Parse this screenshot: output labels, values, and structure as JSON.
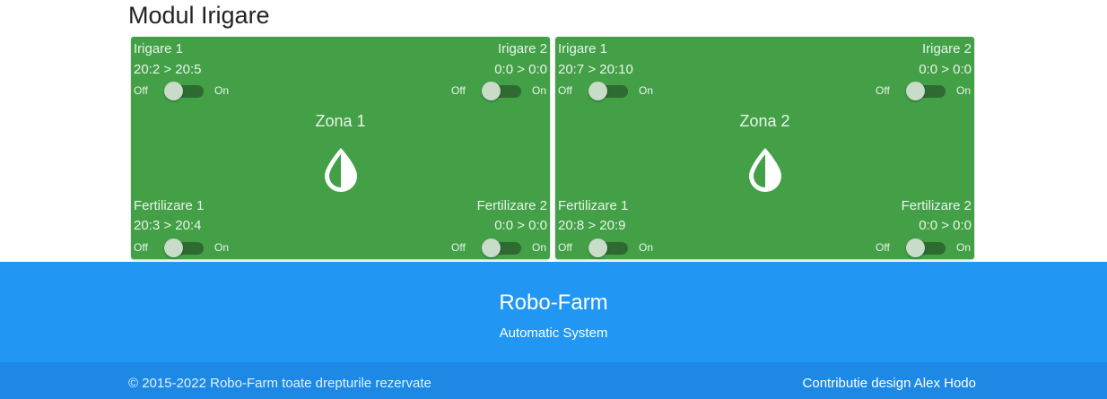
{
  "page": {
    "title": "Modul Irigare"
  },
  "zones": [
    {
      "name": "Zona 1",
      "irigare1": {
        "label": "Irigare 1",
        "schedule": "20:2 > 20:5",
        "off": "Off",
        "on": "On",
        "state": "off"
      },
      "irigare2": {
        "label": "Irigare 2",
        "schedule": "0:0 > 0:0",
        "off": "Off",
        "on": "On",
        "state": "off"
      },
      "fertilizare1": {
        "label": "Fertilizare 1",
        "schedule": "20:3 > 20:4",
        "off": "Off",
        "on": "On",
        "state": "off"
      },
      "fertilizare2": {
        "label": "Fertilizare 2",
        "schedule": "0:0 > 0:0",
        "off": "Off",
        "on": "On",
        "state": "off"
      },
      "icon": "water-drop-icon"
    },
    {
      "name": "Zona 2",
      "irigare1": {
        "label": "Irigare 1",
        "schedule": "20:7 > 20:10",
        "off": "Off",
        "on": "On",
        "state": "off"
      },
      "irigare2": {
        "label": "Irigare 2",
        "schedule": "0:0 > 0:0",
        "off": "Off",
        "on": "On",
        "state": "off"
      },
      "fertilizare1": {
        "label": "Fertilizare 1",
        "schedule": "20:8 > 20:9",
        "off": "Off",
        "on": "On",
        "state": "off"
      },
      "fertilizare2": {
        "label": "Fertilizare 2",
        "schedule": "0:0 > 0:0",
        "off": "Off",
        "on": "On",
        "state": "off"
      },
      "icon": "water-drop-icon"
    }
  ],
  "footer": {
    "title": "Robo-Farm",
    "subtitle": "Automatic System",
    "copyright": "© 2015-2022 Robo-Farm toate drepturile rezervate",
    "credit": "Contributie design Alex Hodo"
  },
  "colors": {
    "card": "#43a047",
    "footer": "#2196f3",
    "copyright_bar": "#1e88e5"
  }
}
